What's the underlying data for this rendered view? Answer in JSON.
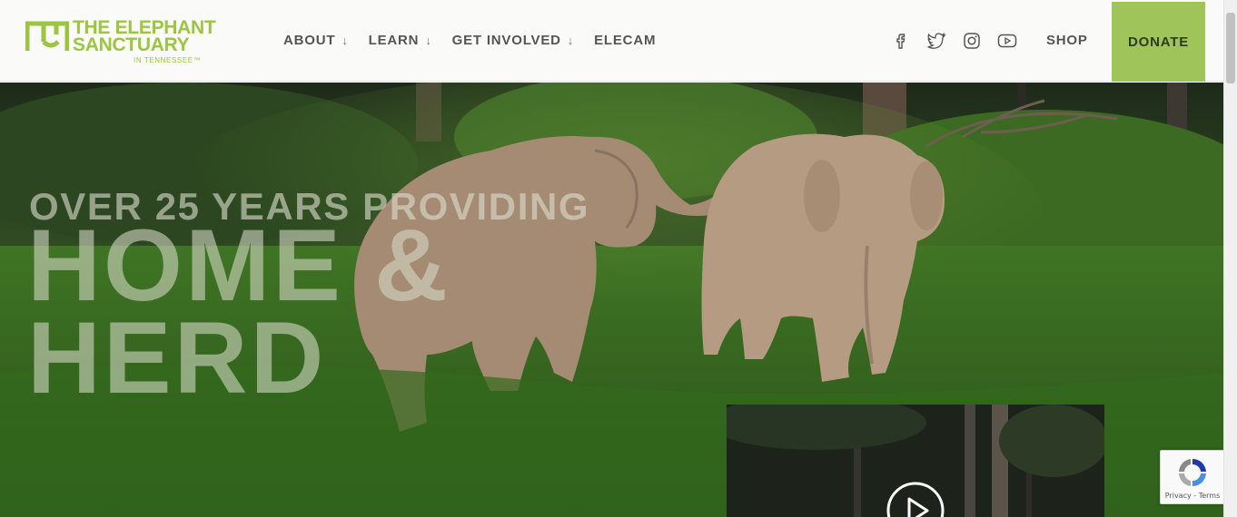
{
  "brand": {
    "line1": "THE ELEPHANT",
    "line2": "SANCTUARY",
    "line3": "IN TENNESSEE™",
    "color": "#9cc542"
  },
  "nav": {
    "items": [
      {
        "label": "ABOUT",
        "has_dropdown": true
      },
      {
        "label": "LEARN",
        "has_dropdown": true
      },
      {
        "label": "GET INVOLVED",
        "has_dropdown": true
      },
      {
        "label": "ELECAM",
        "has_dropdown": false
      }
    ],
    "dropdown_glyph": "↓"
  },
  "socials": [
    "facebook-icon",
    "twitter-icon",
    "instagram-icon",
    "youtube-icon"
  ],
  "shop_label": "SHOP",
  "donate": {
    "label": "DONATE",
    "color": "#9fc45a"
  },
  "hero": {
    "tagline": "OVER 25 YEARS PROVIDING",
    "headline_line1": "HOME &",
    "headline_line2": "HERD"
  },
  "video": {
    "icon": "play-icon"
  },
  "recaptcha": {
    "text": "Privacy - Terms"
  }
}
